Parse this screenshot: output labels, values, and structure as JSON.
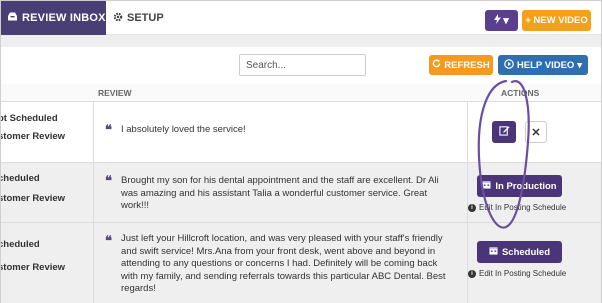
{
  "nav": {
    "review_inbox": "REVIEW INBOX",
    "setup": "SETUP",
    "bolt_caret": "▾",
    "new_video": "+ NEW VIDEO"
  },
  "toolbar": {
    "search_placeholder": "Search...",
    "refresh": "REFRESH",
    "help_video": "HELP VIDEO"
  },
  "table": {
    "col_review": "REVIEW",
    "col_actions": "ACTIONS",
    "rows": [
      {
        "status_line1": "ot Scheduled",
        "status_line2": "stomer Review",
        "review": "I absolutely loved the service!"
      },
      {
        "status_line1": "cheduled",
        "status_line2": "stomer Review",
        "review": "Brought my son for his dental appointment and the staff are excellent. Dr Ali was amazing and his assistant Talia a wonderful customer service. Great work!!!",
        "action_label": "In Production",
        "edit_label": "Edit In Posting Schedule"
      },
      {
        "status_line1": "cheduled",
        "status_line2": "stomer Review",
        "review": "Just left your Hillcroft location, and was very pleased with your staff's friendly and swift service! Mrs.Ana from your front desk, went above and beyond in attending to any questions or concerns I had. Definitely will be coming back with my family, and sending referrals towards this particular ABC Dental. Best regards!",
        "action_label": "Scheduled",
        "edit_label": "Edit In Posting Schedule"
      }
    ]
  },
  "colors": {
    "primary": "#4a3578",
    "orange": "#f39a1f",
    "blue": "#2f6fb0",
    "annotation": "#6a4fa0"
  }
}
